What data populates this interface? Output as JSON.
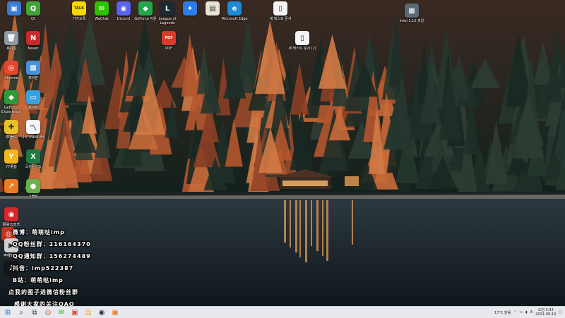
{
  "desktop": {
    "icons": [
      {
        "key": "i0",
        "label": "",
        "glyph": "▣",
        "color": "#3a7bd5"
      },
      {
        "key": "i1",
        "label": "Qt",
        "glyph": "Q",
        "color": "#41a33a"
      },
      {
        "key": "i2",
        "label": "카카오톡",
        "glyph": "TALK",
        "color": "#f7d700"
      },
      {
        "key": "i3",
        "label": "WeChat",
        "glyph": "✉",
        "color": "#2dc100"
      },
      {
        "key": "i4",
        "label": "Discord",
        "glyph": "◉",
        "color": "#5865f2"
      },
      {
        "key": "i5",
        "label": "GeForce 지원",
        "glyph": "◆",
        "color": "#22a84a"
      },
      {
        "key": "i6",
        "label": "League of Legends",
        "glyph": "L",
        "color": "#1b2a33"
      },
      {
        "key": "i7",
        "label": "",
        "glyph": "✦",
        "color": "#2b7de9"
      },
      {
        "key": "i8",
        "label": "",
        "glyph": "▤",
        "color": "#e9e4d6"
      },
      {
        "key": "i9",
        "label": "Microsoft Edge",
        "glyph": "e",
        "color": "#1e8ad6"
      },
      {
        "key": "i10",
        "label": "새 텍스트 문서",
        "glyph": "▯",
        "color": "#f4f4f4"
      },
      {
        "key": "i11",
        "label": "Intel 1.12 파일",
        "glyph": "▦",
        "color": "#5b6a74"
      },
      {
        "key": "i12",
        "label": "휴지통",
        "glyph": "🗑",
        "color": "#8c9aa3"
      },
      {
        "key": "i13",
        "label": "Naver",
        "glyph": "N",
        "color": "#c62b2b"
      },
      {
        "key": "i14",
        "label": "PDF",
        "glyph": "PDF",
        "color": "#d93b2b"
      },
      {
        "key": "i15",
        "label": "새 텍스트 문서 (2)",
        "glyph": "▯",
        "color": "#f4f4f4"
      },
      {
        "key": "i16",
        "label": "Chrome",
        "glyph": "◎",
        "color": "#e5452f"
      },
      {
        "key": "i17",
        "label": "제어판",
        "glyph": "▩",
        "color": "#4a90d9"
      },
      {
        "key": "i18",
        "label": "GeForce Experience",
        "glyph": "◆",
        "color": "#2c9b3a"
      },
      {
        "key": "i19",
        "label": "제어판",
        "glyph": "▭",
        "color": "#3aa1e0"
      },
      {
        "key": "i20",
        "label": "QQ플도",
        "glyph": "✚",
        "color": "#e8c02a"
      },
      {
        "key": "i21",
        "label": "나무 (NAMUH)",
        "glyph": "〽",
        "color": "#f2f6f8"
      },
      {
        "key": "i22",
        "label": "YY语音",
        "glyph": "Y",
        "color": "#f2b51a"
      },
      {
        "key": "i23",
        "label": "곡생들하드",
        "glyph": "X",
        "color": "#1f7a44"
      },
      {
        "key": "i24",
        "label": "",
        "glyph": "↗",
        "color": "#ec7a23"
      },
      {
        "key": "i25",
        "label": "고블린",
        "glyph": "●",
        "color": "#6ab04c"
      },
      {
        "key": "i26",
        "label": "网易云音乐",
        "glyph": "◉",
        "color": "#d8262b"
      },
      {
        "key": "i27",
        "label": "",
        "glyph": "◎",
        "color": "#c4321f"
      },
      {
        "key": "i28",
        "label": "哔哩Tube",
        "glyph": "▶",
        "color": "#d0d0d0"
      },
      {
        "key": "i29",
        "label": "",
        "glyph": "♪",
        "color": "#161616"
      }
    ]
  },
  "overlay": {
    "lines": [
      {
        "key": "o0",
        "icon": "◎",
        "icon_color": "#e6162d",
        "text": "微博：萌萌哒imp"
      },
      {
        "key": "o1",
        "icon": "✦",
        "icon_color": "#12b7f5",
        "text": "QQ粉丝群：216164370"
      },
      {
        "key": "o2",
        "icon": "✦",
        "icon_color": "#12b7f5",
        "text": "QQ通知群：156274489"
      },
      {
        "key": "o3",
        "icon": "♪",
        "icon_color": "#111111",
        "text": "抖音：imp522387"
      },
      {
        "key": "o4",
        "icon": "▶",
        "icon_color": "#fb7299",
        "text": "B站：萌萌哒imp"
      },
      {
        "key": "o5",
        "icon": "",
        "icon_color": "",
        "text": "点我的图子进微信粉丝群"
      },
      {
        "key": "o6",
        "icon": "",
        "icon_color": "",
        "text": "感谢大家的关注OAO"
      }
    ]
  },
  "taskbar": {
    "buttons": [
      {
        "key": "start",
        "glyph": "⊞",
        "color": "#1f6fd1"
      },
      {
        "key": "search",
        "glyph": "⌕",
        "color": "#333"
      },
      {
        "key": "taskview",
        "glyph": "⧉",
        "color": "#333"
      },
      {
        "key": "chrome",
        "glyph": "◎",
        "color": "#e5452f"
      },
      {
        "key": "wechat",
        "glyph": "✉",
        "color": "#2dc100"
      },
      {
        "key": "app1",
        "glyph": "▣",
        "color": "#d64a3b"
      },
      {
        "key": "files",
        "glyph": "▤",
        "color": "#e3b341"
      },
      {
        "key": "app2",
        "glyph": "◉",
        "color": "#2b3440"
      },
      {
        "key": "app3",
        "glyph": "▣",
        "color": "#ec7a23"
      }
    ],
    "tray": {
      "weather": "17°C 맑음",
      "ime": "A",
      "time": "오전 3:33",
      "date": "2021-09-19"
    }
  }
}
